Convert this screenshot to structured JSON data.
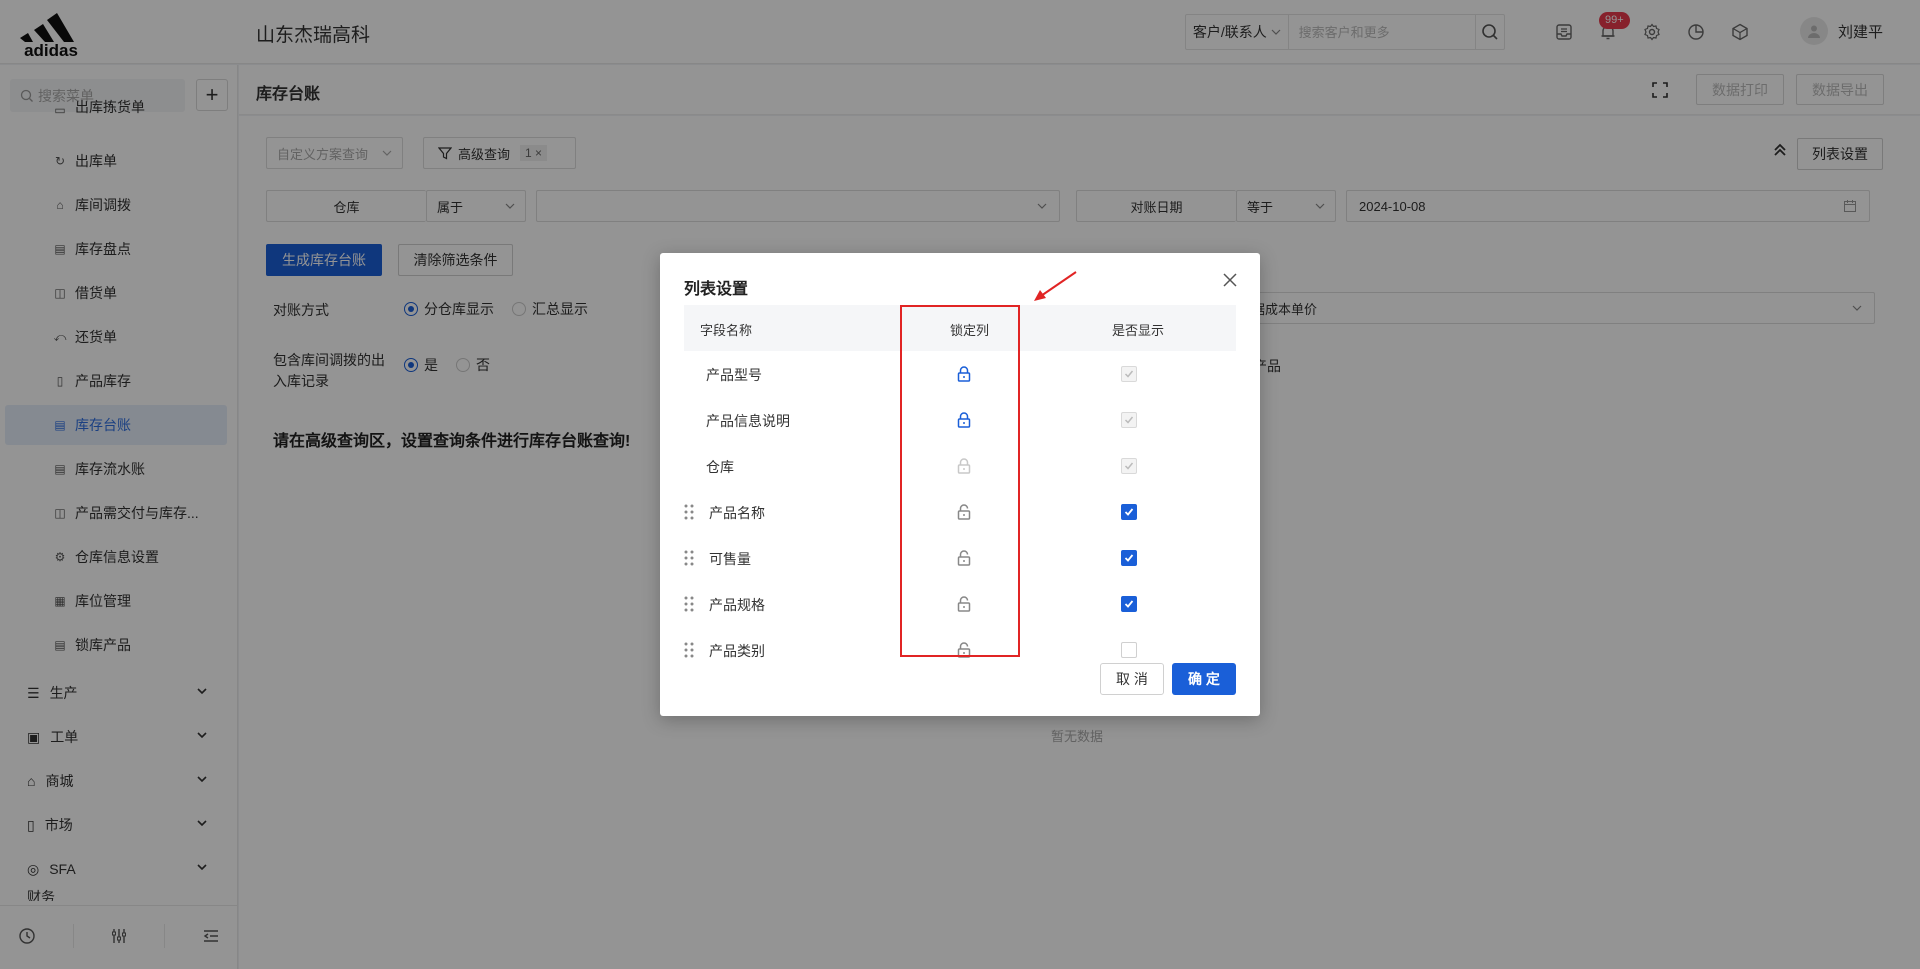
{
  "header": {
    "company": "山东杰瑞高科",
    "search_scope": "客户/联系人",
    "search_placeholder": "搜索客户和更多",
    "notification_count": "99+",
    "user_name": "刘建平"
  },
  "sidebar": {
    "search_placeholder": "搜索菜单",
    "add_label": "+",
    "items": [
      {
        "label": "出库拣货单",
        "icon": "pick-icon"
      },
      {
        "label": "出库单",
        "icon": "outbound-icon"
      },
      {
        "label": "库间调拨",
        "icon": "transfer-icon"
      },
      {
        "label": "库存盘点",
        "icon": "inventory-check-icon"
      },
      {
        "label": "借货单",
        "icon": "borrow-icon"
      },
      {
        "label": "还货单",
        "icon": "return-icon"
      },
      {
        "label": "产品库存",
        "icon": "product-stock-icon"
      },
      {
        "label": "库存台账",
        "icon": "ledger-icon",
        "active": true
      },
      {
        "label": "库存流水账",
        "icon": "flow-icon"
      },
      {
        "label": "产品需交付与库存...",
        "icon": "delivery-icon"
      },
      {
        "label": "仓库信息设置",
        "icon": "settings-icon"
      },
      {
        "label": "库位管理",
        "icon": "location-icon"
      },
      {
        "label": "锁库产品",
        "icon": "lock-product-icon"
      }
    ],
    "groups": [
      {
        "label": "生产"
      },
      {
        "label": "工单"
      },
      {
        "label": "商城"
      },
      {
        "label": "市场"
      },
      {
        "label": "SFA"
      },
      {
        "label": "财务"
      }
    ]
  },
  "page": {
    "title": "库存台账",
    "print_label": "数据打印",
    "export_label": "数据导出",
    "scheme_placeholder": "自定义方案查询",
    "advanced_query_label": "高级查询",
    "advanced_query_count": "1",
    "list_settings_label": "列表设置",
    "filter1_field": "仓库",
    "filter1_op": "属于",
    "filter2_field": "对账日期",
    "filter2_op": "等于",
    "filter2_value": "2024-10-08",
    "generate_label": "生成库存台账",
    "clear_label": "清除筛选条件",
    "recon_label": "对账方式",
    "recon_opt1": "分仓库显示",
    "recon_opt2": "汇总显示",
    "include_label": "包含库间调拨的出入库记录",
    "include_yes": "是",
    "include_no": "否",
    "cost_partial": "据成本单价",
    "product_partial": "产品",
    "hint": "请在高级查询区，设置查询条件进行库存台账查询!",
    "empty": "暂无数据"
  },
  "dialog": {
    "title": "列表设置",
    "col_field": "字段名称",
    "col_lock": "锁定列",
    "col_show": "是否显示",
    "rows": [
      {
        "name": "产品型号",
        "locked": true,
        "lock_state": "locked-active",
        "show": "disabled"
      },
      {
        "name": "产品信息说明",
        "locked": true,
        "lock_state": "locked-active",
        "show": "disabled"
      },
      {
        "name": "仓库",
        "locked": true,
        "lock_state": "locked-disabled",
        "show": "disabled"
      },
      {
        "name": "产品名称",
        "locked": false,
        "lock_state": "unlocked",
        "show": "checked"
      },
      {
        "name": "可售量",
        "locked": false,
        "lock_state": "unlocked",
        "show": "checked"
      },
      {
        "name": "产品规格",
        "locked": false,
        "lock_state": "unlocked",
        "show": "checked"
      },
      {
        "name": "产品类别",
        "locked": false,
        "lock_state": "unlocked",
        "show": "unchecked"
      }
    ],
    "cancel_label": "取 消",
    "ok_label": "确 定"
  },
  "colors": {
    "primary": "#1a5fd8",
    "annotation": "#e12424",
    "badge": "#e8394d"
  }
}
